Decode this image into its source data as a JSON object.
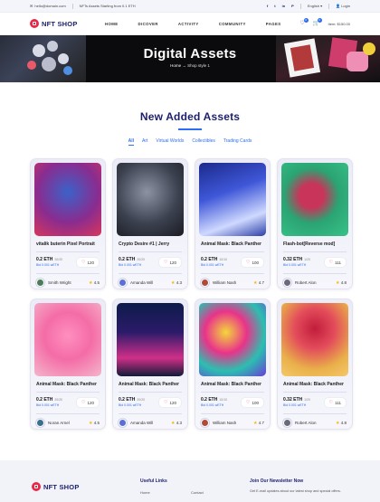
{
  "topbar": {
    "email": "hello@domain.com",
    "promo": "NFTs Assets Starting from 0.1 ETH",
    "social": [
      "f",
      "t",
      "in",
      "P"
    ],
    "language": "English",
    "login": "Login"
  },
  "header": {
    "logo": "NFT SHOP",
    "nav": [
      "HOME",
      "DICOVER",
      "ACTIVITY",
      "COMMUNITY",
      "PAGES"
    ],
    "wishlist_count": "0",
    "cart_count": "0",
    "cart_total": "Item: $150.00"
  },
  "hero": {
    "title": "Digital Assets",
    "breadcrumb_home": "Home",
    "breadcrumb_current": "Shop style 1"
  },
  "section": {
    "title": "New Added Assets",
    "filters": [
      "All",
      "Art",
      "Virtual Worlds",
      "Collectibles",
      "Trading Cards"
    ]
  },
  "cards": [
    {
      "name": "vitalik buterin Pixel Portrait",
      "price": "0.2 ETH",
      "qty": "20/20",
      "bid": "Bid 0.001 wETH",
      "likes": "120",
      "owner": "Smith Wright",
      "rating": "4.5"
    },
    {
      "name": "Crypto Desire #1 | Jerry",
      "price": "0.2 ETH",
      "qty": "20/20",
      "bid": "Bid 0.001 wETH",
      "likes": "120",
      "owner": "Amanda Will",
      "rating": "4.3"
    },
    {
      "name": "Animal Mask: Black Panther",
      "price": "0.2 ETH",
      "qty": "10/10",
      "bid": "Bid 0.001 wETH",
      "likes": "100",
      "owner": "William Nash",
      "rating": "4.7"
    },
    {
      "name": "Flash-bot[Reverse mod]",
      "price": "0.32 ETH",
      "qty": "1/20",
      "bid": "Bid 0.001 wETH",
      "likes": "111",
      "owner": "Robert Alon",
      "rating": "4.8"
    },
    {
      "name": "Animal Mask: Black Panther",
      "price": "0.2 ETH",
      "qty": "20/20",
      "bid": "Bid 0.001 wETH",
      "likes": "120",
      "owner": "Noran Arnel",
      "rating": "4.5"
    },
    {
      "name": "Animal Mask: Black Panther",
      "price": "0.2 ETH",
      "qty": "20/20",
      "bid": "Bid 0.001 wETH",
      "likes": "120",
      "owner": "Amanda Will",
      "rating": "4.3"
    },
    {
      "name": "Animal Mask: Black Panther",
      "price": "0.2 ETH",
      "qty": "10/10",
      "bid": "Bid 0.001 wETH",
      "likes": "100",
      "owner": "William Nash",
      "rating": "4.7"
    },
    {
      "name": "Animal Mask: Black Panther",
      "price": "0.32 ETH",
      "qty": "1/20",
      "bid": "Bid 0.001 wETH",
      "likes": "111",
      "owner": "Robert Alon",
      "rating": "4.8"
    }
  ],
  "footer": {
    "logo": "NFT SHOP",
    "useful_links_title": "Useful Links",
    "link_home": "Home",
    "link_contact": "Contact",
    "newsletter_title": "Join Our Newsletter Now",
    "newsletter_text": "Get E-mail updates about our latest shop and special offers."
  },
  "colors": {
    "brand": "#1c1f6e",
    "accent": "#2c6df5",
    "heart": "#e6294b",
    "star": "#f5b700"
  }
}
